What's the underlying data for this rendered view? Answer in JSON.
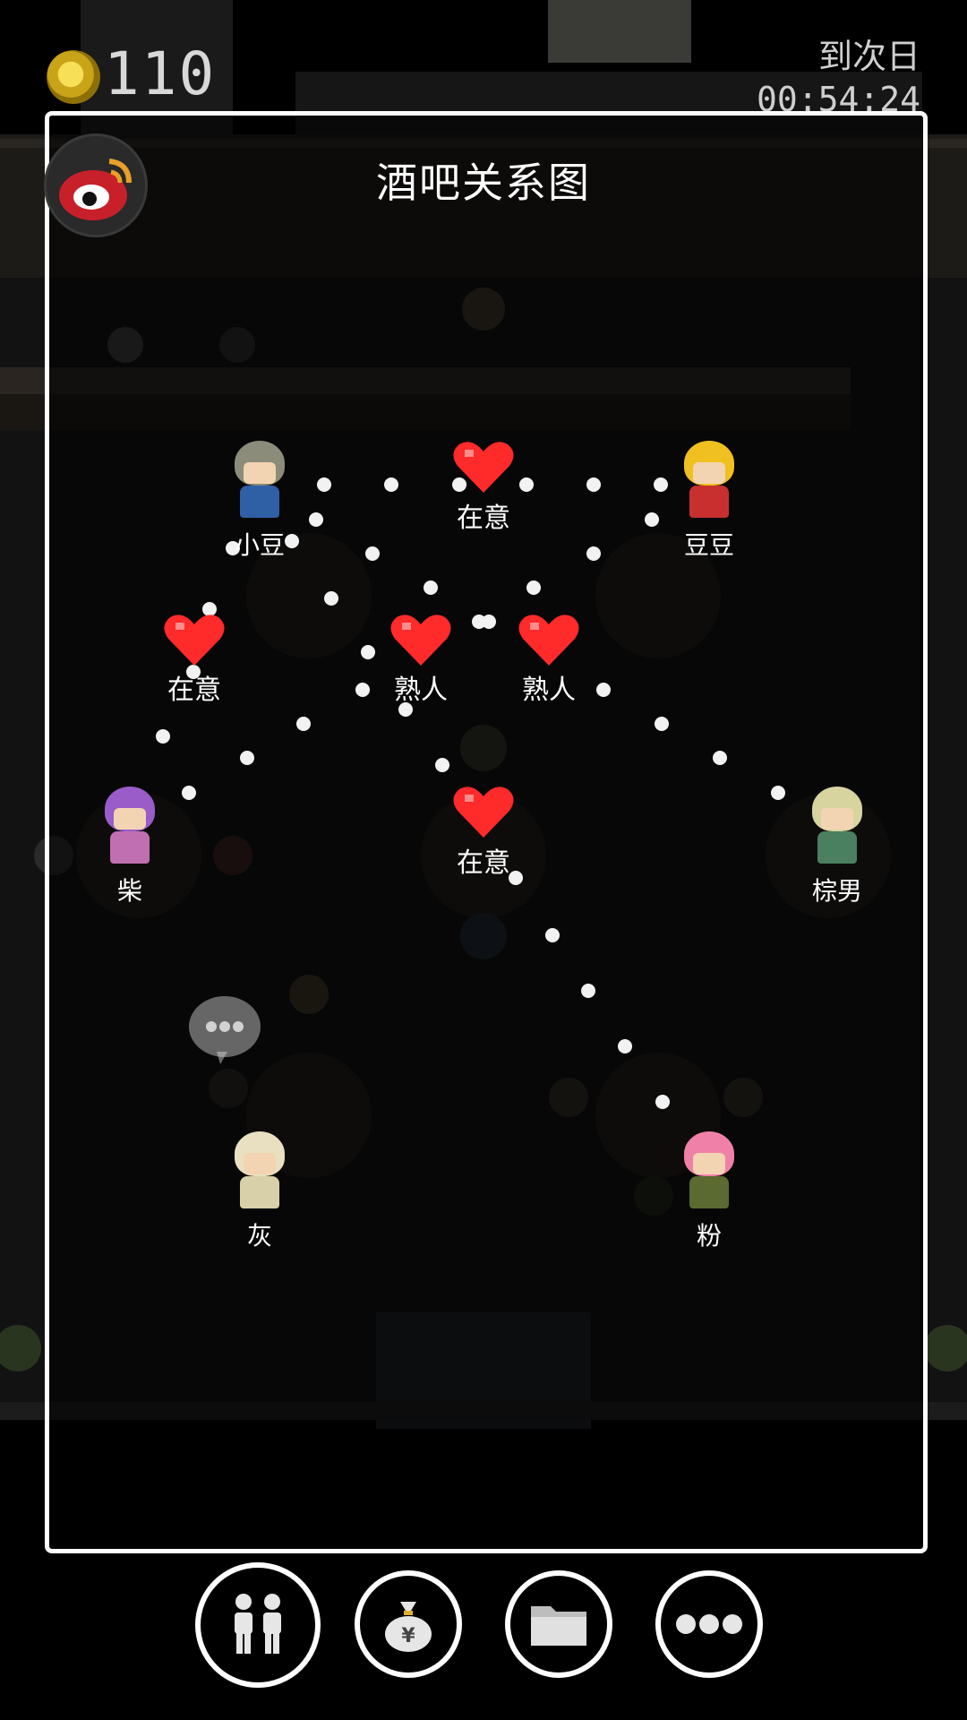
{
  "hud": {
    "coins": "110",
    "next_day_label": "到次日",
    "timer": "00:54:24"
  },
  "panel": {
    "title": "酒吧关系图"
  },
  "characters": [
    {
      "name": "小豆",
      "hair": "#8c8c7a",
      "body": "#2f5fa5"
    },
    {
      "name": "豆豆",
      "hair": "#f0c020",
      "body": "#c83030"
    },
    {
      "name": "柴",
      "hair": "#9a5cc8",
      "body": "#c06fb0"
    },
    {
      "name": "棕男",
      "hair": "#d8d4a0",
      "body": "#4a8060"
    },
    {
      "name": "灰",
      "hair": "#e8e0c0",
      "body": "#d8d0a8"
    },
    {
      "name": "粉",
      "hair": "#f080a8",
      "body": "#5a6a30"
    }
  ],
  "relations": [
    {
      "label": "在意"
    },
    {
      "label": "在意"
    },
    {
      "label": "熟人"
    },
    {
      "label": "熟人"
    },
    {
      "label": "在意"
    }
  ],
  "colors": {
    "heart": "#ff2a2a",
    "panel_border": "#ffffff"
  },
  "buttons": [
    {
      "icon": "people-icon"
    },
    {
      "icon": "money-bag-icon"
    },
    {
      "icon": "folder-icon"
    },
    {
      "icon": "more-dots-icon"
    }
  ]
}
